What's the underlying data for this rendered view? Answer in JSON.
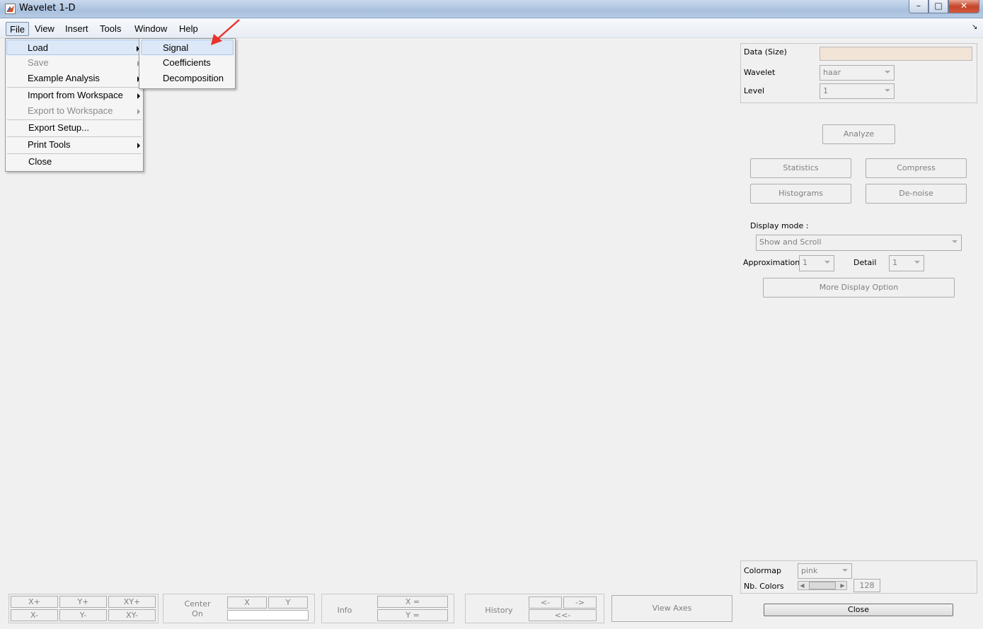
{
  "window": {
    "title": "Wavelet 1-D",
    "controls": {
      "minimize": "–",
      "maximize": "□",
      "close": "✕"
    }
  },
  "menubar": {
    "items": [
      "File",
      "View",
      "Insert",
      "Tools",
      "Window",
      "Help"
    ],
    "corner_glyph": "↘"
  },
  "file_menu": {
    "items": [
      {
        "label": "Load",
        "disabled": false,
        "submenu": true
      },
      {
        "label": "Save",
        "disabled": true,
        "submenu": true
      },
      {
        "label": "Example Analysis",
        "disabled": false,
        "submenu": true
      },
      {
        "label": "Import from Workspace",
        "disabled": false,
        "submenu": true
      },
      {
        "label": "Export to Workspace",
        "disabled": true,
        "submenu": true
      },
      {
        "label": "Export Setup...",
        "disabled": false,
        "submenu": false
      },
      {
        "label": "Print Tools",
        "disabled": false,
        "submenu": true
      },
      {
        "label": "Close",
        "disabled": false,
        "submenu": false
      }
    ]
  },
  "load_submenu": {
    "items": [
      "Signal",
      "Coefficients",
      "Decomposition"
    ]
  },
  "right_panel": {
    "data_size_label": "Data  (Size)",
    "wavelet_label": "Wavelet",
    "wavelet_value": "haar",
    "level_label": "Level",
    "level_value": "1",
    "analyze": "Analyze",
    "statistics": "Statistics",
    "compress": "Compress",
    "histograms": "Histograms",
    "denoise": "De-noise",
    "display_mode_label": "Display mode :",
    "display_mode_value": "Show and Scroll",
    "approximation_label": "Approximation",
    "approximation_value": "1",
    "detail_label": "Detail",
    "detail_value": "1",
    "more_display": "More Display Option",
    "colormap_label": "Colormap",
    "colormap_value": "pink",
    "nb_colors_label": "Nb. Colors",
    "nb_colors_value": "128",
    "close": "Close",
    "data_field_color": "#f3e4d8"
  },
  "bottom_toolbar": {
    "x_plus": "X+",
    "y_plus": "Y+",
    "xy_plus": "XY+",
    "x_minus": "X-",
    "y_minus": "Y-",
    "xy_minus": "XY-",
    "center_label": "Center",
    "on_label": "On",
    "center_x": "X",
    "center_y": "Y",
    "info_label": "Info",
    "info_x": "X =",
    "info_y": "Y =",
    "history_label": "History",
    "hist_back": "<-",
    "hist_fwd": "->",
    "hist_first": "<<-",
    "view_axes": "View Axes"
  }
}
